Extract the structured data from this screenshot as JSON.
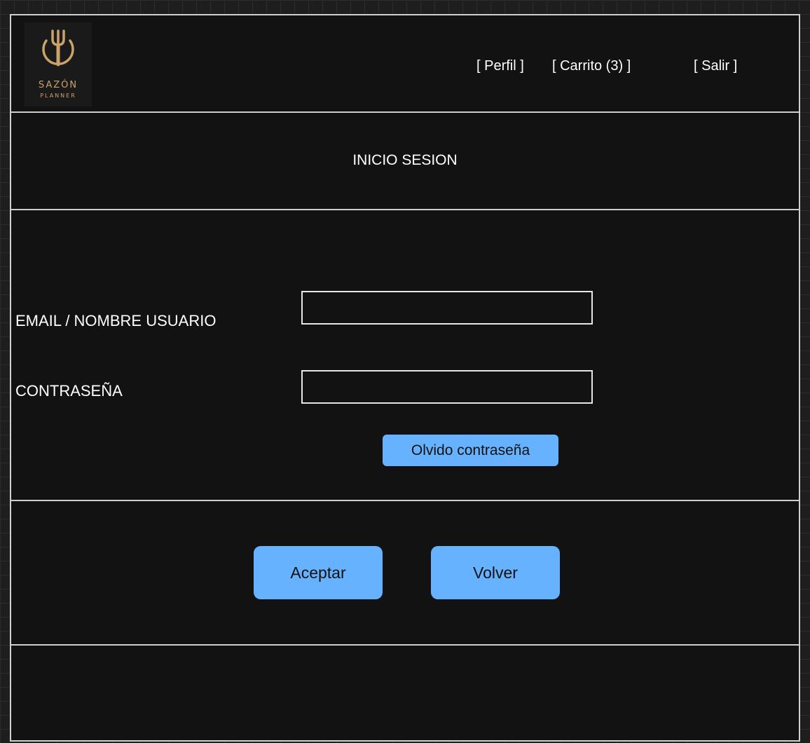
{
  "logo": {
    "icon": "fork-plate-icon",
    "word": "SAZÓN",
    "sub": "PLANNER",
    "color": "#c9a36a"
  },
  "nav": {
    "profile": "[ Perfil ]",
    "cart": "[ Carrito (3) ]",
    "logout": "[ Salir ]"
  },
  "page": {
    "title": "INICIO SESION"
  },
  "form": {
    "email_label": "EMAIL / NOMBRE USUARIO",
    "email_value": "",
    "email_placeholder": "",
    "password_label": "CONTRASEÑA",
    "password_value": "",
    "password_placeholder": "",
    "forgot_label": "Olvido contraseña"
  },
  "actions": {
    "accept_label": "Aceptar",
    "back_label": "Volver"
  },
  "colors": {
    "button": "#66b2ff",
    "background": "#121212",
    "border": "#cfcfcf"
  }
}
